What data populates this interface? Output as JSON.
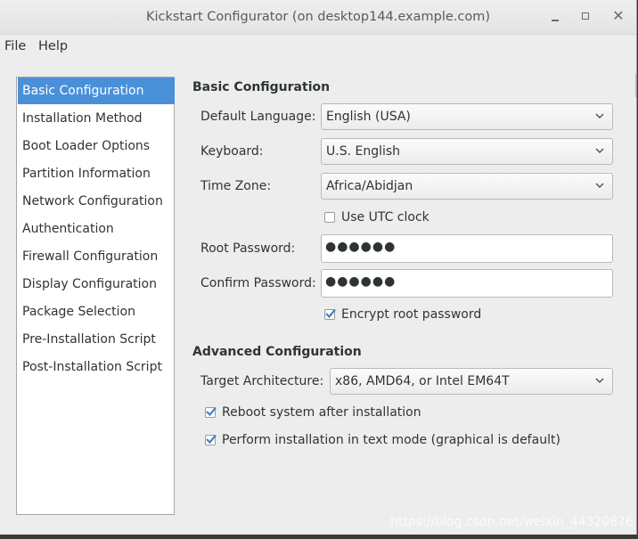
{
  "window": {
    "title": "Kickstart Configurator (on desktop144.example.com)",
    "close_glyph": "✕"
  },
  "menu": {
    "file": "File",
    "help": "Help"
  },
  "sidebar": {
    "items": [
      {
        "label": "Basic Configuration",
        "selected": true
      },
      {
        "label": "Installation Method"
      },
      {
        "label": "Boot Loader Options"
      },
      {
        "label": "Partition Information"
      },
      {
        "label": "Network Configuration"
      },
      {
        "label": "Authentication"
      },
      {
        "label": "Firewall Configuration"
      },
      {
        "label": "Display Configuration"
      },
      {
        "label": "Package Selection"
      },
      {
        "label": "Pre-Installation Script"
      },
      {
        "label": "Post-Installation Script"
      }
    ]
  },
  "basic": {
    "title": "Basic Configuration",
    "language_label": "Default Language:",
    "language_value": "English (USA)",
    "keyboard_label": "Keyboard:",
    "keyboard_value": "U.S. English",
    "timezone_label": "Time Zone:",
    "timezone_value": "Africa/Abidjan",
    "utc_label": "Use UTC clock",
    "utc_checked": false,
    "root_password_label": "Root Password:",
    "root_password_mask": "●●●●●●",
    "confirm_password_label": "Confirm Password:",
    "confirm_password_mask": "●●●●●●",
    "encrypt_label": "Encrypt root password",
    "encrypt_checked": true
  },
  "advanced": {
    "title": "Advanced Configuration",
    "arch_label": "Target Architecture:",
    "arch_value": "x86, AMD64, or Intel EM64T",
    "reboot_label": "Reboot system after installation",
    "reboot_checked": true,
    "textmode_label": "Perform installation in text mode (graphical is default)",
    "textmode_checked": true
  },
  "watermark": "https://blog.csdn.net/weixin_44320876",
  "colors": {
    "selection": "#4a90d9",
    "window_bg": "#ededed",
    "check": "#4a7fc0"
  }
}
